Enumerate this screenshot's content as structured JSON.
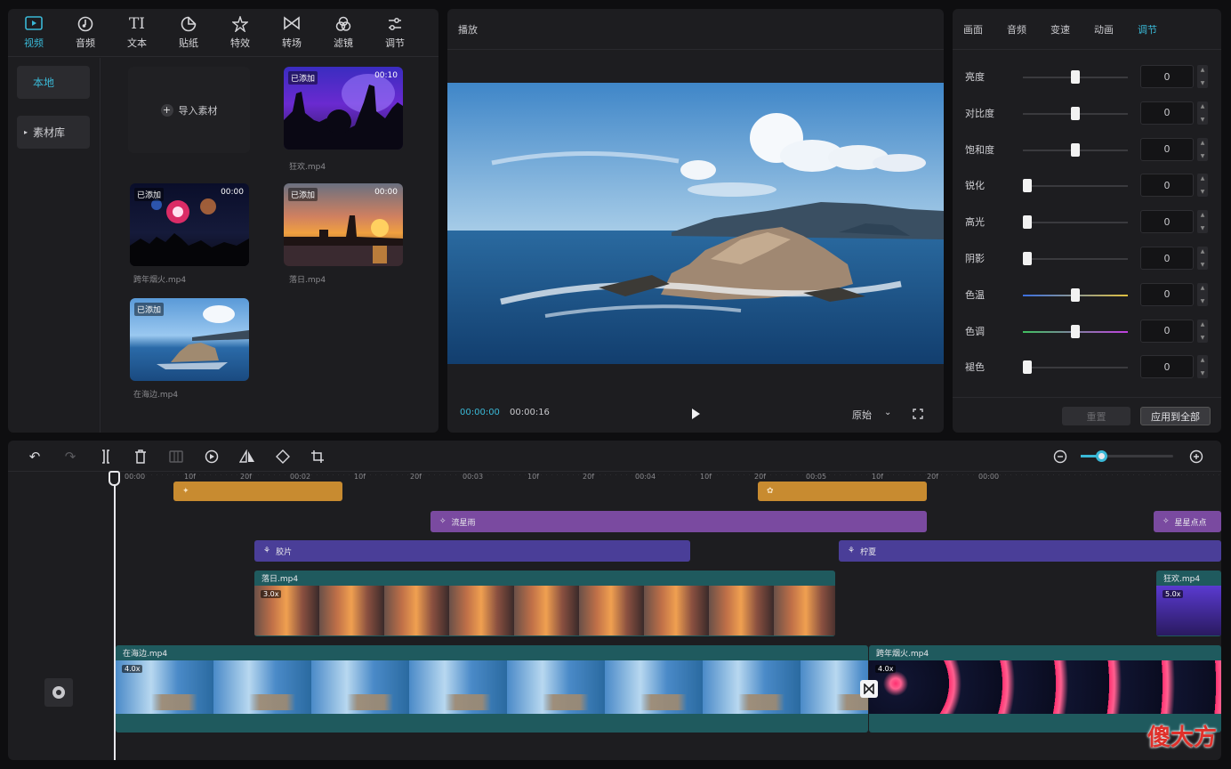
{
  "nav": {
    "items": [
      {
        "label": "视频",
        "icon": "video-icon"
      },
      {
        "label": "音频",
        "icon": "audio-icon"
      },
      {
        "label": "文本",
        "icon": "text-icon"
      },
      {
        "label": "贴纸",
        "icon": "sticker-icon"
      },
      {
        "label": "特效",
        "icon": "effects-icon"
      },
      {
        "label": "转场",
        "icon": "transition-icon"
      },
      {
        "label": "滤镜",
        "icon": "filter-icon"
      },
      {
        "label": "调节",
        "icon": "adjust-icon"
      }
    ],
    "active": "视频"
  },
  "sidebar": {
    "items": [
      {
        "label": "本地"
      },
      {
        "label": "素材库"
      }
    ]
  },
  "media": {
    "import_label": "导入素材",
    "clips": [
      {
        "name": "狂欢.mp4",
        "badge": "已添加",
        "duration": "00:10"
      },
      {
        "name": "跨年烟火.mp4",
        "badge": "已添加",
        "duration": "00:00"
      },
      {
        "name": "落日.mp4",
        "badge": "已添加",
        "duration": "00:00"
      },
      {
        "name": "在海边.mp4",
        "badge": "已添加",
        "duration": ""
      }
    ]
  },
  "player": {
    "title": "播放",
    "current_time": "00:00:00",
    "total_time": "00:00:16",
    "ratio_label": "原始"
  },
  "adjust": {
    "tabs": [
      "画面",
      "音频",
      "变速",
      "动画",
      "调节"
    ],
    "active_tab": "调节",
    "rows": [
      {
        "label": "亮度",
        "value": "0",
        "level": 0.5
      },
      {
        "label": "对比度",
        "value": "0",
        "level": 0.5
      },
      {
        "label": "饱和度",
        "value": "0",
        "level": 0.5
      },
      {
        "label": "锐化",
        "value": "0",
        "level": 0
      },
      {
        "label": "高光",
        "value": "0",
        "level": 0
      },
      {
        "label": "阴影",
        "value": "0",
        "level": 0
      },
      {
        "label": "色温",
        "value": "0",
        "level": 0.5,
        "track_colors": [
          "#3a6ee0",
          "#e0c040"
        ]
      },
      {
        "label": "色调",
        "value": "0",
        "level": 0.5,
        "track_colors": [
          "#40c060",
          "#c040e0"
        ]
      },
      {
        "label": "褪色",
        "value": "0",
        "level": 0
      }
    ],
    "reset_label": "重置",
    "apply_all_label": "应用到全部"
  },
  "timeline": {
    "ruler": [
      {
        "t": "00:00",
        "sub": [
          "10f",
          "20f"
        ]
      },
      {
        "t": "00:02",
        "sub": [
          "10f",
          "20f"
        ]
      },
      {
        "t": "00:03",
        "sub": [
          "10f",
          "20f"
        ]
      },
      {
        "t": "00:04",
        "sub": [
          "10f",
          "20f"
        ]
      },
      {
        "t": "00:05",
        "sub": [
          "10f",
          "20f"
        ]
      },
      {
        "t": "00:00",
        "sub": []
      }
    ],
    "effect_clips": [
      "流星雨",
      "星星点点"
    ],
    "filter_clips": [
      "胶片",
      "柠夏"
    ],
    "overlay_clips": [
      {
        "name": "落日.mp4",
        "speed": "3.0x"
      },
      {
        "name": "狂欢.mp4",
        "speed": "5.0x"
      }
    ],
    "main_clips": [
      {
        "name": "在海边.mp4",
        "speed": "4.0x"
      },
      {
        "name": "跨年烟火.mp4",
        "speed": "4.0x"
      }
    ]
  },
  "watermark": "傻大方"
}
